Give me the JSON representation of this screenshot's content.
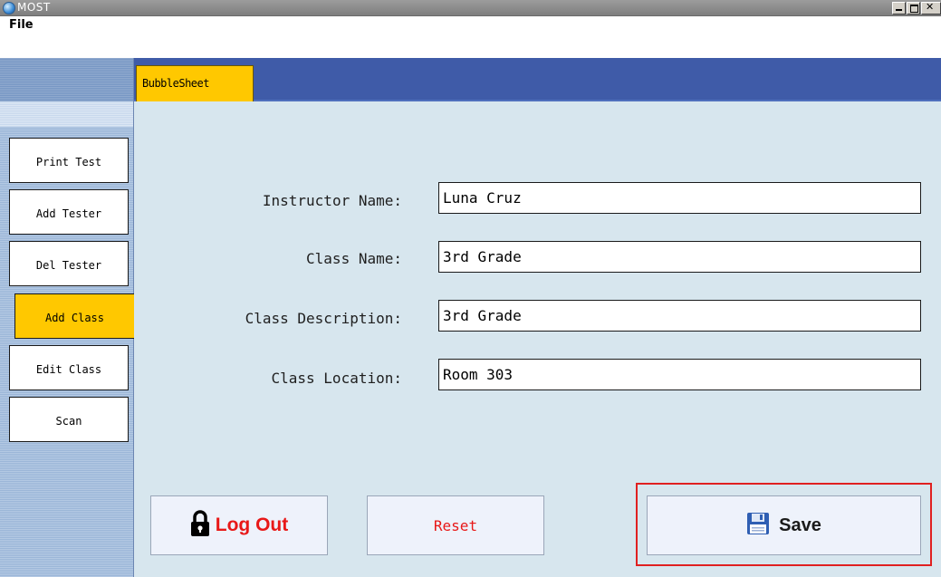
{
  "window": {
    "title": "MOST"
  },
  "menu": {
    "file": "File"
  },
  "sidebar": {
    "items": [
      {
        "label": "Print Test"
      },
      {
        "label": "Add Tester"
      },
      {
        "label": "Del Tester"
      },
      {
        "label": "Add Class",
        "active": true
      },
      {
        "label": "Edit Class"
      },
      {
        "label": "Scan"
      }
    ]
  },
  "tabs": [
    {
      "label": "BubbleSheet",
      "active": true
    }
  ],
  "form": {
    "instructor_name": {
      "label": "Instructor Name:",
      "value": "Luna Cruz"
    },
    "class_name": {
      "label": "Class Name:",
      "value": "3rd Grade"
    },
    "class_description": {
      "label": "Class Description:",
      "value": "3rd Grade"
    },
    "class_location": {
      "label": "Class Location:",
      "value": "Room 303"
    }
  },
  "buttons": {
    "logout": "Log Out",
    "reset": "Reset",
    "save": "Save"
  },
  "colors": {
    "accent_yellow": "#ffc800",
    "tab_bar_blue": "#3f5ba8",
    "panel_bg": "#d7e6ee",
    "danger_red": "#e81818",
    "highlight_red": "#e02020"
  },
  "icons": {
    "logout": "padlock-icon",
    "save": "floppy-disk-icon",
    "app": "globe-icon"
  }
}
